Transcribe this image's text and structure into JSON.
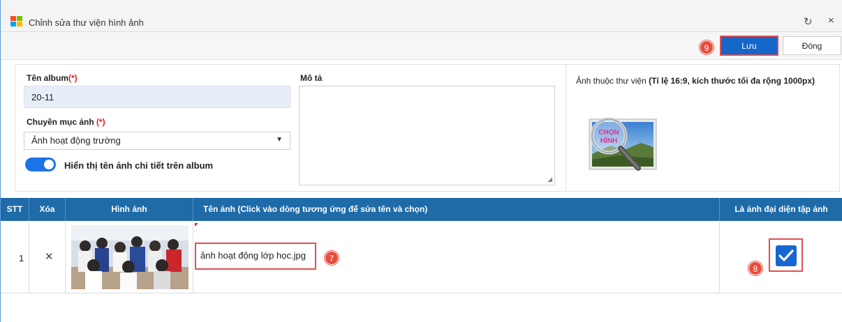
{
  "window": {
    "title": "Chỉnh sửa thư viện hình ảnh",
    "refresh_icon": "↻",
    "close_icon": "×"
  },
  "toolbar": {
    "save_badge": "9",
    "save_label": "Lưu",
    "close_label": "Đóng"
  },
  "form": {
    "album_name_label": "Tên album",
    "album_name_req": "(*)",
    "album_name_value": "20-11",
    "category_label": "Chuyên mục ảnh ",
    "category_req": "(*)",
    "category_value": "Ảnh hoạt động trường",
    "show_name_toggle_on": true,
    "show_name_label": "Hiển thị tên ảnh chi tiết trên album",
    "description_label": "Mô tả",
    "description_value": "",
    "library_image_label_prefix": "Ảnh thuộc thư viện ",
    "library_image_label_note": "(Tỉ lệ 16:9, kích thước tối đa rộng 1000px)",
    "choose_image_text": [
      "CHỌN",
      "HÌNH"
    ]
  },
  "table": {
    "headers": [
      "STT",
      "Xóa",
      "Hình ảnh",
      "Tên ảnh (Click vào dòng tương ứng để sửa tên và chọn)",
      "Là ảnh đại diện tập ảnh"
    ],
    "rows": [
      {
        "stt": "1",
        "delete_icon": "✕",
        "image_name": "ảnh hoạt động lớp học.jpg",
        "name_badge": "7",
        "is_cover": true,
        "cover_badge": "8"
      }
    ]
  },
  "colors": {
    "header_blue": "#1e6ba8",
    "primary_button": "#1466c8",
    "badge_red": "#e84c3d",
    "highlight_border": "#e05050"
  }
}
